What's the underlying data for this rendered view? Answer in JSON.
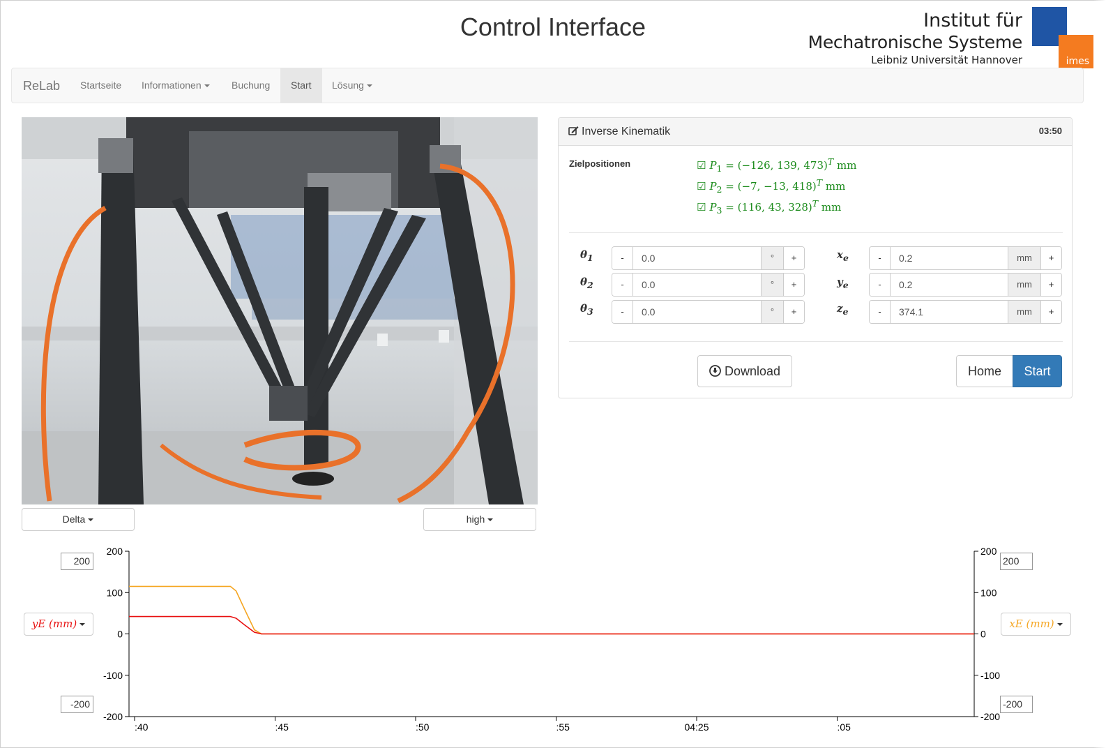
{
  "header": {
    "title": "Control Interface",
    "logo": {
      "line1": "Institut für",
      "line2": "Mechatronische Systeme",
      "line3": "Leibniz Universität Hannover",
      "badge": "imes",
      "colors": {
        "blue": "#1f55a5",
        "orange": "#f47b20"
      }
    }
  },
  "navbar": {
    "brand": "ReLab",
    "items": [
      {
        "label": "Startseite",
        "dropdown": false,
        "active": false
      },
      {
        "label": "Informationen",
        "dropdown": true,
        "active": false
      },
      {
        "label": "Buchung",
        "dropdown": false,
        "active": false
      },
      {
        "label": "Start",
        "dropdown": false,
        "active": true
      },
      {
        "label": "Lösung",
        "dropdown": true,
        "active": false
      }
    ]
  },
  "camera": {
    "robot_select": "Delta",
    "quality_select": "high"
  },
  "panel": {
    "title": "Inverse Kinematik",
    "title_icon": "edit-icon",
    "timer": "03:50",
    "targets_label": "Zielpositionen",
    "targets": [
      {
        "name": "P",
        "sub": "1",
        "coords": "(−126, 139, 473)",
        "exp": "T",
        "unit": "mm"
      },
      {
        "name": "P",
        "sub": "2",
        "coords": "(−7, −13, 418)",
        "exp": "T",
        "unit": "mm"
      },
      {
        "name": "P",
        "sub": "3",
        "coords": "(116, 43, 328)",
        "exp": "T",
        "unit": "mm"
      }
    ],
    "joints": [
      {
        "symbol": "θ",
        "sub": "1",
        "value": "0.0",
        "unit": "°"
      },
      {
        "symbol": "θ",
        "sub": "2",
        "value": "0.0",
        "unit": "°"
      },
      {
        "symbol": "θ",
        "sub": "3",
        "value": "0.0",
        "unit": "°"
      }
    ],
    "positions": [
      {
        "symbol": "x",
        "sub": "e",
        "value": "0.2",
        "unit": "mm"
      },
      {
        "symbol": "y",
        "sub": "e",
        "value": "0.2",
        "unit": "mm"
      },
      {
        "symbol": "z",
        "sub": "e",
        "value": "374.1",
        "unit": "mm"
      }
    ],
    "minus_label": "-",
    "plus_label": "+",
    "download_label": "Download",
    "home_label": "Home",
    "start_label": "Start"
  },
  "chart_controls": {
    "left_max": "200",
    "left_min": "-200",
    "right_max": "200",
    "right_min": "-200",
    "left_series_select": "yE (mm)",
    "right_series_select": "xE (mm)"
  },
  "chart_data": {
    "type": "line",
    "ylim": [
      -200,
      200
    ],
    "yticks": [
      200,
      100,
      0,
      -100,
      -200
    ],
    "xticks": [
      ":40",
      ":45",
      ":50",
      ":55",
      "04:25",
      ":05"
    ],
    "series": [
      {
        "name": "yE (mm)",
        "color": "#e81010",
        "points": [
          [
            0,
            42
          ],
          [
            3.6,
            42
          ],
          [
            3.8,
            38
          ],
          [
            4.1,
            22
          ],
          [
            4.45,
            4
          ],
          [
            4.7,
            0
          ],
          [
            30,
            0
          ]
        ]
      },
      {
        "name": "xE (mm)",
        "color": "#f5a623",
        "points": [
          [
            0,
            115
          ],
          [
            3.6,
            115
          ],
          [
            3.8,
            104
          ],
          [
            4.1,
            60
          ],
          [
            4.45,
            10
          ],
          [
            4.7,
            0
          ],
          [
            30,
            0
          ]
        ]
      }
    ],
    "x_range_ticks": [
      0,
      30
    ]
  }
}
